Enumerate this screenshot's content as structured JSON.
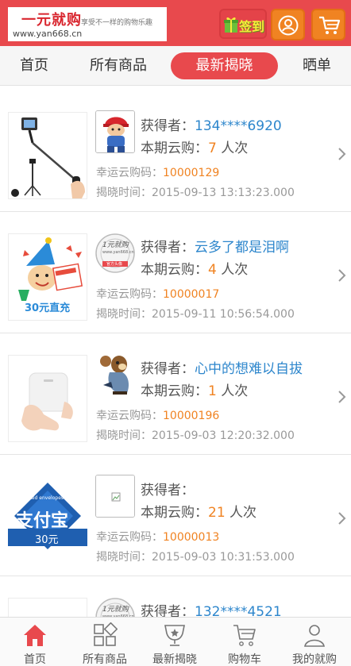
{
  "header": {
    "logo_brand": "一元就购",
    "logo_url": "www.yan668.cn",
    "logo_slogan": "享受不一样的购物乐趣",
    "sign_label": "签到"
  },
  "tabs": [
    "首页",
    "所有商品",
    "最新揭晓",
    "晒单"
  ],
  "active_tab": "最新揭晓",
  "labels": {
    "winner_prefix": "获得者：",
    "buy_prefix": "本期云购：",
    "buy_suffix": "人次",
    "code_prefix": "幸运云购码：",
    "time_prefix": "揭晓时间："
  },
  "items": [
    {
      "winner": "134****6920",
      "count": "7",
      "code": "10000129",
      "time": "2015-09-13 13:13:23.000",
      "product": "selfie-stick",
      "avatar": "cartoon-boy"
    },
    {
      "winner": "云多了都是泪啊",
      "count": "4",
      "code": "10000017",
      "time": "2015-09-11 10:56:54.000",
      "product": "30元直充",
      "avatar": "yan668-logo"
    },
    {
      "winner": "心中的想难以自拔",
      "count": "1",
      "code": "10000196",
      "time": "2015-09-03 12:20:32.000",
      "product": "xiaomi-box",
      "avatar": "cartoon-rat"
    },
    {
      "winner": "",
      "count": "21",
      "code": "10000013",
      "time": "2015-09-03 10:31:53.000",
      "product": "支付宝 30元",
      "avatar": "broken-image"
    },
    {
      "winner": "132****4521",
      "count": "",
      "code": "",
      "time": "",
      "product": "",
      "avatar": "yan668-logo"
    }
  ],
  "product_text": {
    "alipay_badge": "Red envelopes",
    "alipay_name": "支付宝",
    "alipay_value": "30元",
    "recharge": "30元直充",
    "avatar_logo_top": "1元就购",
    "avatar_logo_url": "www.yan668.cn",
    "avatar_logo_bottom": "官方头像"
  },
  "bottom_nav": [
    {
      "label": "首页",
      "icon": "home-icon"
    },
    {
      "label": "所有商品",
      "icon": "grid-icon"
    },
    {
      "label": "最新揭晓",
      "icon": "trophy-icon"
    },
    {
      "label": "购物车",
      "icon": "cart-icon"
    },
    {
      "label": "我的就购",
      "icon": "user-icon"
    }
  ],
  "colors": {
    "header_red": "#e8494d",
    "accent_orange": "#f08322",
    "link_blue": "#2d86cc"
  }
}
